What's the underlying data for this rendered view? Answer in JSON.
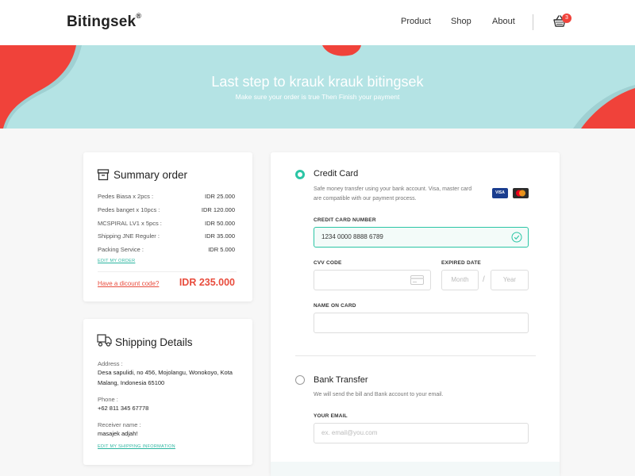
{
  "header": {
    "logo": "Bitingsek",
    "logo_mark": "®",
    "nav": [
      "Product",
      "Shop",
      "About"
    ],
    "cart_count": "3",
    "cart_icon": "basket-icon"
  },
  "hero": {
    "title": "Last step to krauk krauk bitingsek",
    "subtitle": "Make sure your order is true Then Finish your payment"
  },
  "summary": {
    "title": "Summary order",
    "icon": "box-icon",
    "items": [
      {
        "label": "Pedes Biasa x 2pcs :",
        "value": "IDR 25.000"
      },
      {
        "label": "Pedes banget  x 10pcs :",
        "value": "IDR 120.000"
      },
      {
        "label": "MCSPIRAL LV1 x 5pcs :",
        "value": "IDR 50.000"
      },
      {
        "label": "Shipping JNE Reguler :",
        "value": "IDR 35.000"
      },
      {
        "label": "Packing Service :",
        "value": "IDR 5.000"
      }
    ],
    "edit_link": "EDIT MY ORDER",
    "promo_link": "Have a dicount code?",
    "total": "IDR 235.000"
  },
  "shipping": {
    "title": "Shipping Details",
    "icon": "delivery-truck-icon",
    "address_label": "Address :",
    "address": "Desa sapulidi, no 456, Mojolangu, Wonokoyo, Kota Malang, Indonesia 65100",
    "phone_label": "Phone :",
    "phone": "+62 811 345 67778",
    "receiver_label": "Receiver name :",
    "receiver": "masajek adjah!",
    "edit_link": "EDIT MY SHIPPING INFORMATION"
  },
  "payment": {
    "credit_card": {
      "title": "Credit Card",
      "description": "Safe money transfer using your bank account. Visa, master card are compatible with our payment process.",
      "card_number_label": "CREDIT CARD NUMBER",
      "card_number": "1234 0000 8888 6789",
      "cvv_label": "CVV CODE",
      "expired_label": "EXPIRED DATE",
      "month_placeholder": "Month",
      "year_placeholder": "Year",
      "separator": "/",
      "name_label": "NAME ON CARD",
      "visa_text": "VISA",
      "selected": true
    },
    "bank_transfer": {
      "title": "Bank Transfer",
      "description": "We will send the bill and Bank account to your email.",
      "email_label": "YOUR EMAIL",
      "email_placeholder": "ex. email@you.com",
      "selected": false
    }
  },
  "colors": {
    "accent": "#2bc5a5",
    "coral": "#f0423a",
    "hero_bg": "#b4e3e4",
    "total_red": "#e84c3d"
  }
}
